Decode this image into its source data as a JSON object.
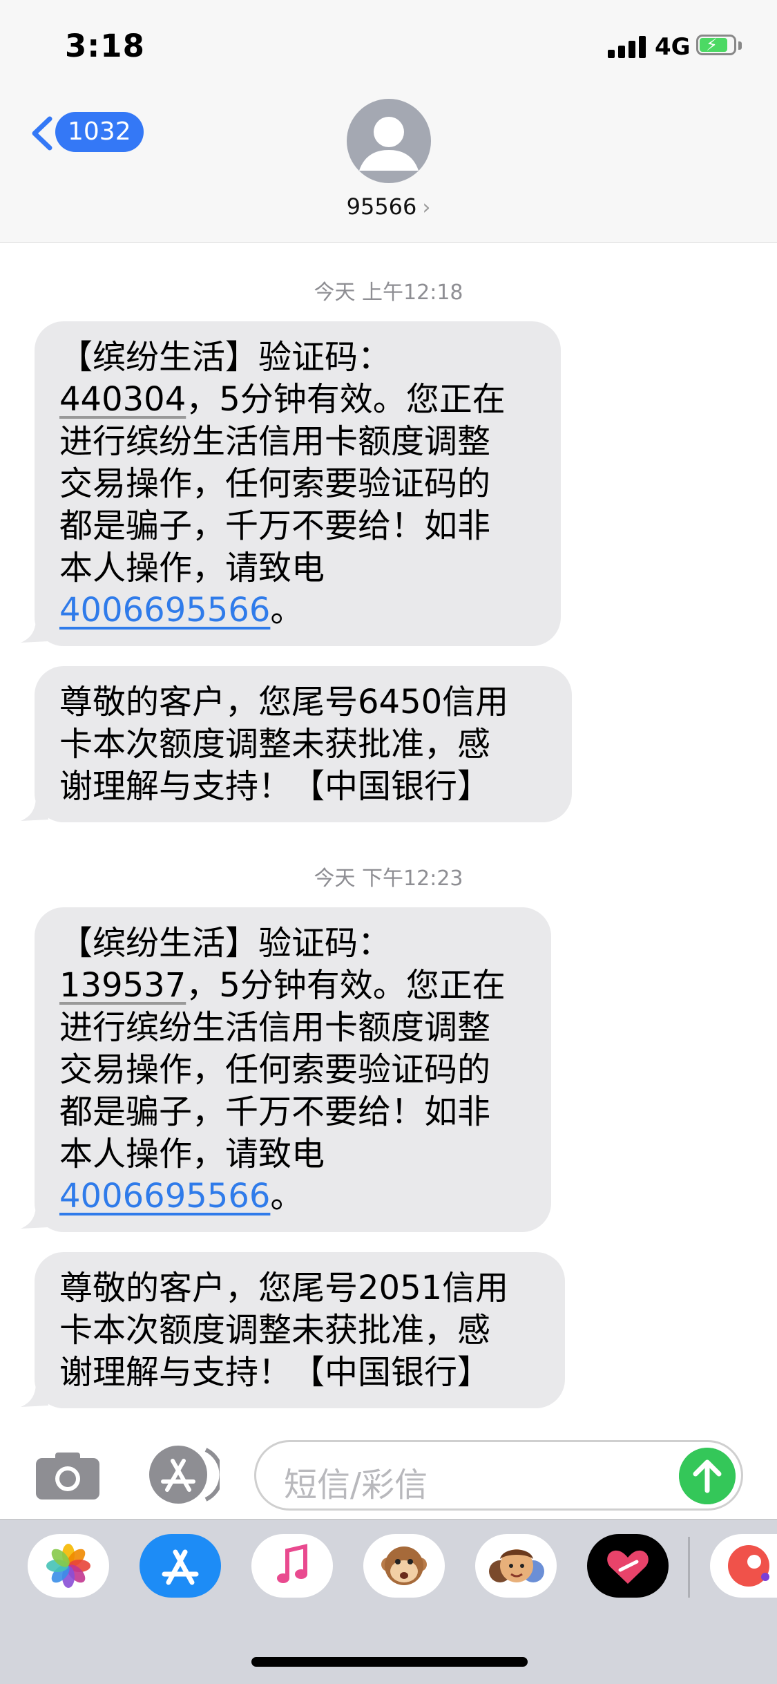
{
  "status_bar": {
    "time": "3:18",
    "network": "4G"
  },
  "header": {
    "back_count": "1032",
    "contact": "95566"
  },
  "messages": [
    {
      "timestamp": "今天 上午12:18",
      "bubbles": [
        {
          "lines": [
            "【缤纷生活】验证码：",
            "",
            "进行缤纷生活信用卡额度调整",
            "交易操作，任何索要验证码的",
            "都是骗子，千万不要给！如非",
            "本人操作，请致电",
            ""
          ],
          "code": "440304",
          "code_suffix": "，5分钟有效。您正在",
          "phone": "4006695566",
          "phone_suffix": "。"
        },
        {
          "lines": [
            "尊敬的客户，您尾号6450信用",
            "卡本次额度调整未获批准，感",
            "谢理解与支持！【中国银行】"
          ]
        }
      ]
    },
    {
      "timestamp": "今天 下午12:23",
      "bubbles": [
        {
          "lines": [
            "【缤纷生活】验证码：",
            "",
            "进行缤纷生活信用卡额度调整",
            "交易操作，任何索要验证码的",
            "都是骗子，千万不要给！如非",
            "本人操作，请致电",
            ""
          ],
          "code": "139537",
          "code_suffix": "，5分钟有效。您正在",
          "phone": "4006695566",
          "phone_suffix": "。"
        },
        {
          "lines": [
            "尊敬的客户，您尾号2051信用",
            "卡本次额度调整未获批准，感",
            "谢理解与支持！【中国银行】"
          ]
        }
      ]
    }
  ],
  "composer": {
    "placeholder": "短信/彩信"
  },
  "icons": [
    "back-chevron-icon",
    "contact-avatar-icon",
    "camera-icon",
    "app-store-icon",
    "send-arrow-icon",
    "photos-icon",
    "music-icon",
    "animoji-icon",
    "memoji-icon",
    "digital-touch-icon"
  ],
  "colors": {
    "accent": "#3478f6",
    "bubble": "#e9e9eb",
    "send": "#34c759",
    "link": "#2f7bea"
  }
}
